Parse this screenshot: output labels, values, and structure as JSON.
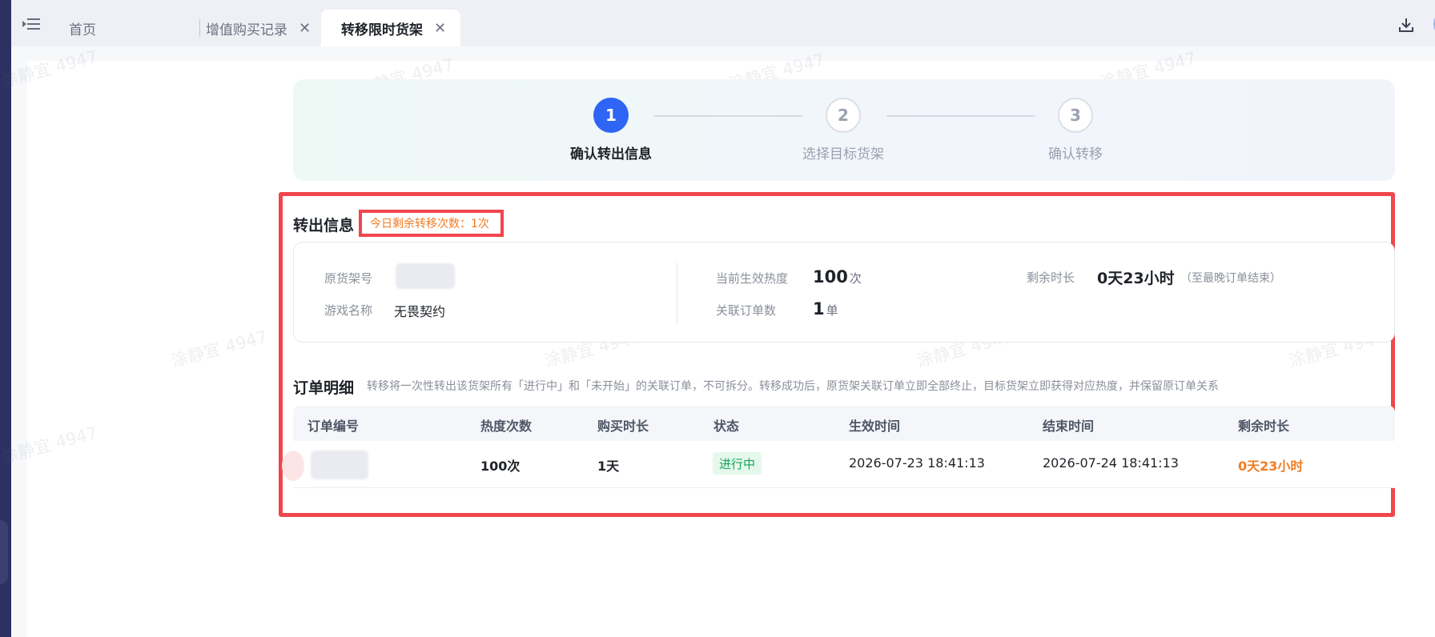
{
  "tabs": [
    {
      "label": "首页"
    },
    {
      "label": "增值购买记录",
      "close": "✕"
    },
    {
      "label": "转移限时货架",
      "close": "✕"
    }
  ],
  "watermark": "涂静宜 4947",
  "steps": [
    {
      "num": "1",
      "label": "确认转出信息",
      "state": "active"
    },
    {
      "num": "2",
      "label": "选择目标货架",
      "state": "todo"
    },
    {
      "num": "3",
      "label": "确认转移",
      "state": "todo"
    }
  ],
  "transfer_info": {
    "title": "转出信息",
    "remain_badge": "今日剩余转移次数：1次",
    "orig_shelf_label": "原货架号",
    "game_label": "游戏名称",
    "game_value": "无畏契约",
    "heat_label": "当前生效热度",
    "heat_value": "100",
    "heat_unit": "次",
    "orders_label": "关联订单数",
    "orders_value": "1",
    "orders_unit": "单",
    "remain_label": "剩余时长",
    "remain_value": "0天23小时",
    "remain_hint": "（至最晚订单结束）"
  },
  "order_detail": {
    "title": "订单明细",
    "desc": "转移将一次性转出该货架所有「进行中」和「未开始」的关联订单，不可拆分。转移成功后，原货架关联订单立即全部终止，目标货架立即获得对应热度，并保留原订单关系",
    "columns": [
      "订单编号",
      "热度次数",
      "购买时长",
      "状态",
      "生效时间",
      "结束时间",
      "剩余时长"
    ],
    "rows": [
      {
        "heat": "100次",
        "duration": "1天",
        "status": "进行中",
        "start": "2026-07-23 18:41:13",
        "end": "2026-07-24 18:41:13",
        "remain": "0天23小时"
      }
    ]
  },
  "colors": {
    "primary": "#2f65f5",
    "highlight": "#f0464e",
    "warning": "#f07c23",
    "success": "#19a55a"
  }
}
